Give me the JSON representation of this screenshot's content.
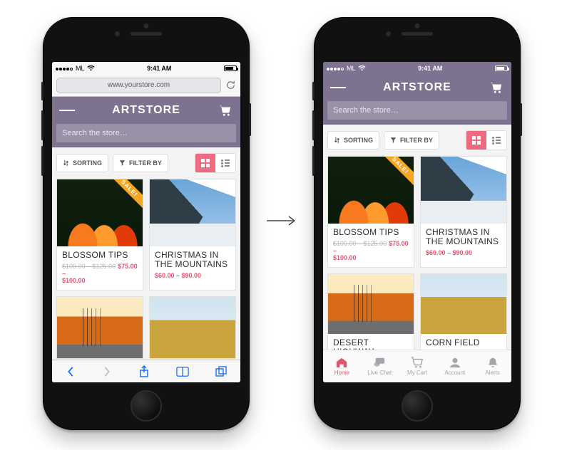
{
  "status": {
    "carrier": "ML",
    "time": "9:41 AM"
  },
  "safari": {
    "url": "www.yourstore.com"
  },
  "app": {
    "brand": "ARTSTORE",
    "search_placeholder": "Search the store…",
    "sort_label": "SORTING",
    "filter_label": "FILTER BY"
  },
  "sale_badge": "SALE!",
  "products": [
    {
      "title": "BLOSSOM TIPS",
      "strike": "$100.00 – $125.00",
      "now_line1": "$75.00 –",
      "now_line2": "$100.00",
      "sale": true,
      "art": "art-tulip"
    },
    {
      "title": "CHRISTMAS IN THE MOUNTAINS",
      "range": "$60.00 – $90.00",
      "art": "art-mountain"
    },
    {
      "title": "DESERT HIGHWAY",
      "range": "",
      "art": "art-desert"
    },
    {
      "title": "CORN FIELD",
      "range": "",
      "art": "art-field"
    }
  ],
  "tabs": [
    {
      "label": "Home"
    },
    {
      "label": "Live Chat"
    },
    {
      "label": "My Cart"
    },
    {
      "label": "Account"
    },
    {
      "label": "Alerts"
    }
  ]
}
